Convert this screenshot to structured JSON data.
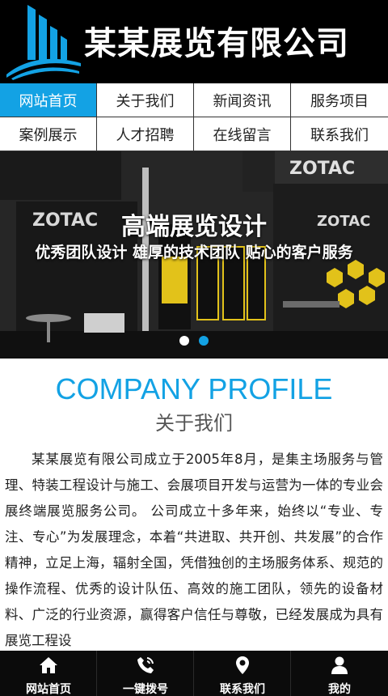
{
  "header": {
    "company_name": "某某展览有限公司",
    "logo_icon": "building-bars-logo",
    "accent": "#13a2e4"
  },
  "nav": {
    "items": [
      {
        "label": "网站首页",
        "active": true
      },
      {
        "label": "关于我们"
      },
      {
        "label": "新闻资讯"
      },
      {
        "label": "服务项目"
      },
      {
        "label": "案例展示"
      },
      {
        "label": "人才招聘"
      },
      {
        "label": "在线留言"
      },
      {
        "label": "联系我们"
      }
    ]
  },
  "banner": {
    "title": "高端展览设计",
    "subtitle": "优秀团队设计 雄厚的技术团队 贴心的客户服务",
    "booth_brand": "ZOTAC",
    "slides": 2,
    "active_slide": 2
  },
  "profile": {
    "heading_en": "COMPANY PROFILE",
    "heading_cn": "关于我们",
    "body": "某某展览有限公司成立于2005年8月，是集主场服务与管理、特装工程设计与施工、会展项目开发与运营为一体的专业会展终端展览服务公司。 公司成立十多年来，始终以“专业、专注、专心”为发展理念，本着“共进取、共开创、共发展”的合作精神，立足上海，辐射全国，凭借独创的主场服务体系、规范的操作流程、优秀的设计队伍、高效的施工团队，领先的设备材料、广泛的行业资源，赢得客户信任与尊敬，已经发展成为具有展览工程设"
  },
  "bottom_bar": {
    "items": [
      {
        "label": "网站首页",
        "icon": "home-icon"
      },
      {
        "label": "一键拨号",
        "icon": "phone-icon"
      },
      {
        "label": "联系我们",
        "icon": "location-pin-icon"
      },
      {
        "label": "我的",
        "icon": "user-icon"
      }
    ]
  }
}
